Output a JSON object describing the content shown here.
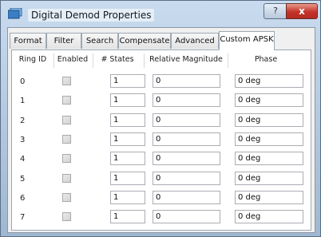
{
  "window": {
    "title": "Digital Demod Properties",
    "help_label": "?",
    "close_label": "x"
  },
  "tabs": [
    {
      "label": "Format"
    },
    {
      "label": "Filter"
    },
    {
      "label": "Search"
    },
    {
      "label": "Compensate"
    },
    {
      "label": "Advanced"
    },
    {
      "label": "Custom APSK"
    }
  ],
  "active_tab": "Custom APSK",
  "table": {
    "headers": [
      "Ring ID",
      "Enabled",
      "# States",
      "Relative Magnitude",
      "Phase"
    ],
    "rows": [
      {
        "ring_id": "0",
        "enabled": false,
        "states": "1",
        "magnitude": "0",
        "phase": "0 deg"
      },
      {
        "ring_id": "1",
        "enabled": false,
        "states": "1",
        "magnitude": "0",
        "phase": "0 deg"
      },
      {
        "ring_id": "2",
        "enabled": false,
        "states": "1",
        "magnitude": "0",
        "phase": "0 deg"
      },
      {
        "ring_id": "3",
        "enabled": false,
        "states": "1",
        "magnitude": "0",
        "phase": "0 deg"
      },
      {
        "ring_id": "4",
        "enabled": false,
        "states": "1",
        "magnitude": "0",
        "phase": "0 deg"
      },
      {
        "ring_id": "5",
        "enabled": false,
        "states": "1",
        "magnitude": "0",
        "phase": "0 deg"
      },
      {
        "ring_id": "6",
        "enabled": false,
        "states": "1",
        "magnitude": "0",
        "phase": "0 deg"
      },
      {
        "ring_id": "7",
        "enabled": false,
        "states": "1",
        "magnitude": "0",
        "phase": "0 deg"
      }
    ]
  }
}
